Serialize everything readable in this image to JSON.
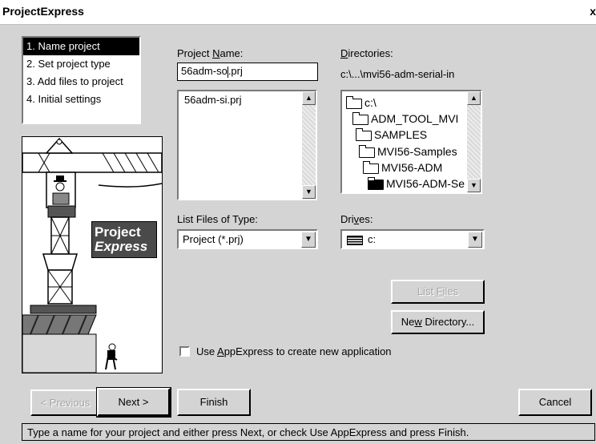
{
  "window": {
    "title": "ProjectExpress",
    "close_glyph": "x"
  },
  "steps": [
    {
      "label": "1. Name project",
      "selected": true
    },
    {
      "label": "2. Set project type",
      "selected": false
    },
    {
      "label": "3. Add files to project",
      "selected": false
    },
    {
      "label": "4. Initial settings",
      "selected": false
    }
  ],
  "logo": {
    "line1": "Project",
    "line2": "Express"
  },
  "project_name": {
    "label_pre": "Project ",
    "label_acc": "N",
    "label_post": "ame:",
    "value_pre": "56adm-so",
    "value_post": ".prj"
  },
  "files": {
    "items": [
      "56adm-si.prj"
    ]
  },
  "directories": {
    "label_pre": "",
    "label_acc": "D",
    "label_post": "irectories:",
    "current_path": "c:\\...\\mvi56-adm-serial-in",
    "tree": [
      "c:\\",
      "ADM_TOOL_MVI",
      "SAMPLES",
      "MVI56-Samples",
      "MVI56-ADM",
      "MVI56-ADM-Se"
    ]
  },
  "file_type": {
    "label": "List Files of Type:",
    "value": "Project (*.prj)"
  },
  "drives": {
    "label_pre": "Dri",
    "label_acc": "v",
    "label_post": "es:",
    "value": "c:",
    "icon": "drive-icon"
  },
  "buttons": {
    "list_files_pre": "List ",
    "list_files_acc": "F",
    "list_files_post": "iles",
    "new_dir_pre": "Ne",
    "new_dir_acc": "w",
    "new_dir_post": " Directory...",
    "previous": "< Previous",
    "next": "Next >",
    "finish": "Finish",
    "cancel": "Cancel"
  },
  "appexpress": {
    "pre": "Use ",
    "acc": "A",
    "post": "ppExpress to create new application",
    "checked": false
  },
  "status": "Type a name for your project and either press Next, or check Use AppExpress and press Finish."
}
